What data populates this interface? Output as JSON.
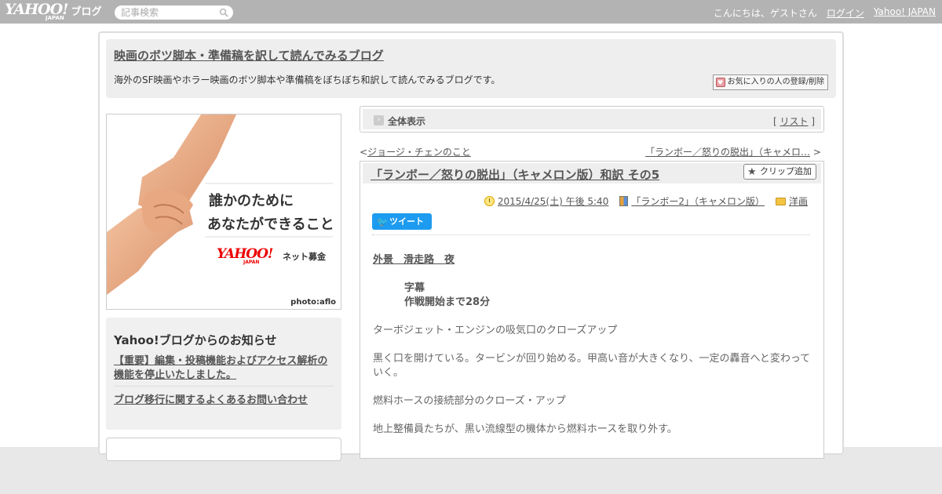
{
  "topbar": {
    "logo_main": "YAHOO!",
    "logo_sub": "JAPAN",
    "logo_blog": "ブログ",
    "search_placeholder": "記事検索",
    "greeting": "こんにちは、ゲストさん",
    "login": "ログイン",
    "yahoo_japan": "Yahoo! JAPAN"
  },
  "header": {
    "title": "映画のボツ脚本・準備稿を訳して読んでみるブログ",
    "description": "海外のSF映画やホラー映画のボツ脚本や準備稿をぼちぼち和訳して読んでみるブログです。",
    "favorite_button": "お気に入りの人の登録/削除"
  },
  "banner": {
    "line1": "誰かのために",
    "line2": "あなたができること",
    "logo": "YAHOO!",
    "logo_sub": "JAPAN",
    "tag": "ネット募金",
    "credit": "photo:aflo"
  },
  "notice": {
    "title": "Yahoo!ブログからのお知らせ",
    "items": [
      "【重要】編集・投稿機能およびアクセス解析の機能を停止いたしました。",
      "ブログ移行に関するよくあるお問い合わせ"
    ]
  },
  "allview": {
    "label": "全体表示",
    "list_link": "リスト",
    "bracket_open": "[",
    "bracket_close": "]"
  },
  "nav": {
    "prev_arrow": "<",
    "prev_label": "ジョージ・チェンのこと",
    "next_label": "「ランボー／怒りの脱出」（キャメロ…",
    "next_arrow": ">"
  },
  "article": {
    "title": "「ランボー／怒りの脱出」（キャメロン版）和訳 その5",
    "clip_button": "クリップ追加",
    "date": "2015/4/25(土) 午後 5:40",
    "book": "「ランボー2」（キャメロン版）",
    "category": "洋画",
    "tweet": "ツイート",
    "body": {
      "scene": "外景　滑走路　夜",
      "caption1": "字幕",
      "caption2": "作戦開始まで28分",
      "p1": "ターボジェット・エンジンの吸気口のクローズアップ",
      "p2": "黒く口を開けている。タービンが回り始める。甲高い音が大きくなり、一定の轟音へと変わっていく。",
      "p3": "燃料ホースの接続部分のクローズ・アップ",
      "p4": "地上整備員たちが、黒い流線型の機体から燃料ホースを取り外す。"
    }
  },
  "colors": {
    "topbar": "#b3b3b3",
    "header_bg": "#eeeeee",
    "tweet": "#1d9bf0",
    "yahoo_red": "#ee0000"
  }
}
